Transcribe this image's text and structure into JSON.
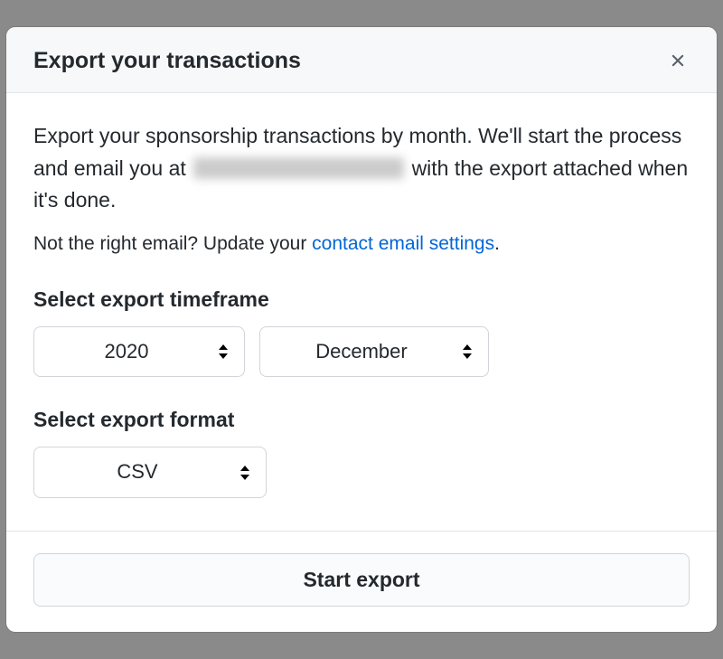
{
  "modal": {
    "title": "Export your transactions",
    "description_prefix": "Export your sponsorship transactions by month. We'll start the process and email you at",
    "description_suffix": "with the export attached when it's done.",
    "hint_prefix": "Not the right email? Update your ",
    "hint_link": "contact email settings",
    "hint_suffix": "."
  },
  "timeframe": {
    "label": "Select export timeframe",
    "year": "2020",
    "month": "December"
  },
  "format": {
    "label": "Select export format",
    "value": "CSV"
  },
  "footer": {
    "start_label": "Start export"
  }
}
